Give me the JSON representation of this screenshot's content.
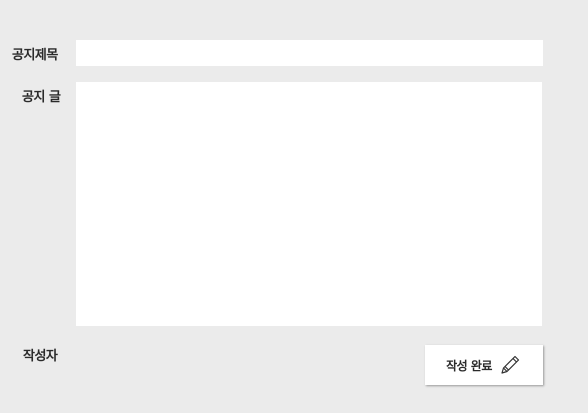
{
  "form": {
    "title_label": "공지제목",
    "content_label": "공지 글",
    "author_label": "작성자",
    "title_value": "",
    "content_value": "",
    "submit_label": "작성 완료"
  },
  "icons": {
    "submit_icon": "pencil-icon"
  },
  "colors": {
    "background": "#ebebeb",
    "field_background": "#ffffff",
    "label_text": "#2a2a2a"
  }
}
